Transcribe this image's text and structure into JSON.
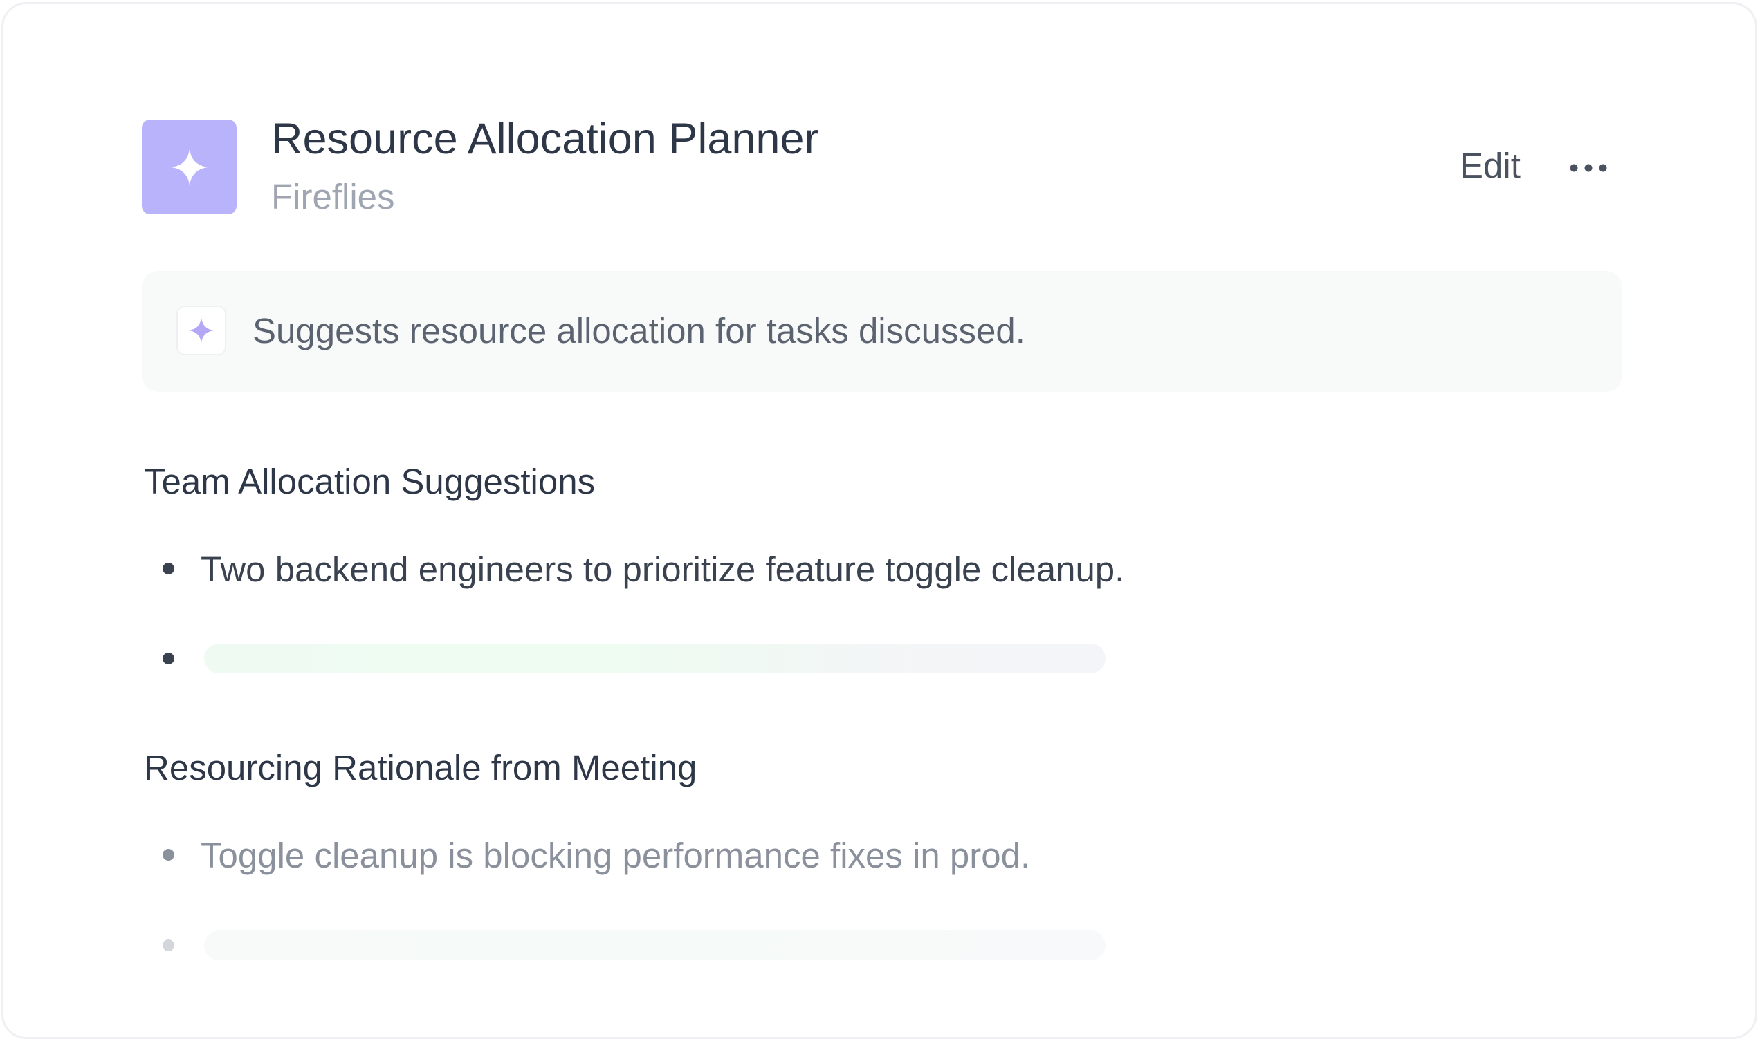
{
  "header": {
    "title": "Resource Allocation Planner",
    "subtitle": "Fireflies",
    "edit_label": "Edit",
    "app_icon": "sparkle-icon",
    "more_icon": "more-horizontal-icon"
  },
  "summary": {
    "text": "Suggests resource allocation for tasks discussed.",
    "icon": "sparkle-icon"
  },
  "sections": [
    {
      "heading": "Team Allocation Suggestions",
      "items": [
        "Two backend engineers to prioritize feature toggle cleanup."
      ]
    },
    {
      "heading": "Resourcing Rationale from Meeting",
      "items": [
        "Toggle cleanup is blocking performance fixes in prod."
      ]
    }
  ],
  "colors": {
    "accent": "#b8b3fb",
    "text_primary": "#2d3748",
    "text_muted": "#a0a6b1",
    "loading_tint": "#eefcf1"
  }
}
